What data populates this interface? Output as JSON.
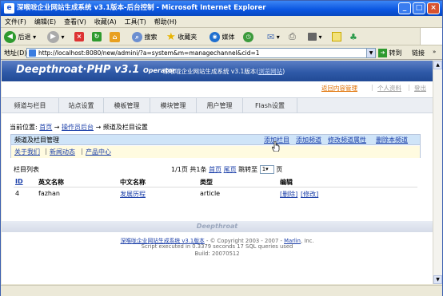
{
  "window": {
    "title": "深喉咙企业网站生成系统 v3.1版本-后台控制 - Microsoft Internet Explorer"
  },
  "menu": [
    "文件(F)",
    "编辑(E)",
    "查看(V)",
    "收藏(A)",
    "工具(T)",
    "帮助(H)"
  ],
  "toolbar": {
    "back": "后退",
    "search": "搜索",
    "favorites": "收藏夹",
    "media": "媒体"
  },
  "address": {
    "label": "地址(D)",
    "url": "http://localhost:8080/new/admini/?a=system&m=managechannel&cid=1",
    "go": "转到",
    "links": "链接"
  },
  "header": {
    "logo": "Deepthroat·PHP v3.1",
    "logo_sub": "Operator",
    "subtitle": "深喉咙企业网站生成系统 v3.1版本(",
    "subtitle_link": "浏览网站",
    "subtitle_end": ")"
  },
  "toplinks": {
    "home": "返回内容管理",
    "account": "个人资料",
    "logout": "登出"
  },
  "nav": [
    "频道与栏目",
    "站点设置",
    "模板管理",
    "模块管理",
    "用户管理",
    "Flash设置"
  ],
  "breadcrumb": {
    "prefix": "当前位置:",
    "home": "首页",
    "operator": "操作员后台",
    "current": "频道及栏目设置"
  },
  "panel": {
    "title": "频道及栏目管理",
    "actions": [
      "添加栏目",
      "添加频道",
      "修改频道属性",
      "删除本频道"
    ],
    "channels": [
      "关于我们",
      "新闻动态",
      "产品中心"
    ]
  },
  "list": {
    "title": "栏目列表",
    "pager": {
      "info": "1/1页 共1条",
      "first": "首页",
      "last": "尾页",
      "jump": "跳转至",
      "page": "1",
      "page_suffix": "页"
    },
    "headers": [
      "ID",
      "英文名称",
      "中文名称",
      "类型",
      "编辑"
    ],
    "rows": [
      {
        "id": "4",
        "en": "fazhan",
        "cn": "发展历程",
        "type": "article",
        "del": "[删除]",
        "edit": "[修改]"
      }
    ]
  },
  "footer": {
    "brand": "Deepthroat",
    "line1_link": "深喉咙企业网站生成系统 v3.1版本",
    "line1_mid": " - © Copyright 2003 - 2007 - ",
    "line1_author": "Marlin",
    "line1_end": ", Inc.",
    "line2": "Script executed in 0.3379 seconds 17 SQL queries used",
    "line3": "Build: 20070512"
  }
}
